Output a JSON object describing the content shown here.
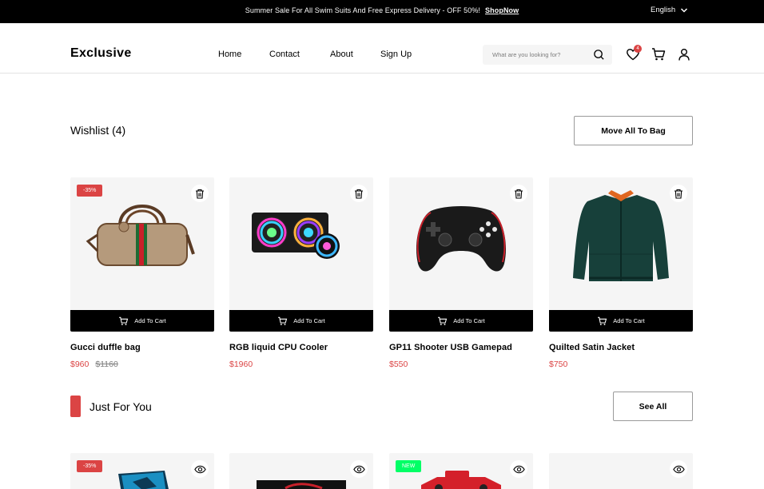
{
  "topbar": {
    "promo_text": "Summer Sale For All Swim Suits And Free Express Delivery - OFF 50%!",
    "promo_link": "ShopNow",
    "language": "English"
  },
  "header": {
    "logo": "Exclusive",
    "nav": [
      "Home",
      "Contact",
      "About",
      "Sign Up"
    ],
    "search_placeholder": "What are you looking for?",
    "wishlist_count": "4"
  },
  "wishlist": {
    "title": "Wishlist (4)",
    "move_all_label": "Move All To Bag",
    "add_to_cart_label": "Add To Cart",
    "items": [
      {
        "name": "Gucci duffle bag",
        "price": "$960",
        "old_price": "$1160",
        "discount": "-35%"
      },
      {
        "name": "RGB liquid CPU Cooler",
        "price": "$1960"
      },
      {
        "name": "GP11 Shooter USB Gamepad",
        "price": "$550"
      },
      {
        "name": "Quilted Satin Jacket",
        "price": "$750"
      }
    ]
  },
  "just_for_you": {
    "title": "Just For You",
    "see_all_label": "See All",
    "items": [
      {
        "badge": "-35%",
        "badge_type": "discount"
      },
      {
        "badge": "",
        "badge_type": ""
      },
      {
        "badge": "NEW",
        "badge_type": "new"
      },
      {
        "badge": "",
        "badge_type": ""
      }
    ]
  },
  "colors": {
    "accent": "#DB4444",
    "new_badge": "#00FF66",
    "card_bg": "#F5F5F5",
    "topbar_bg": "#000000"
  }
}
